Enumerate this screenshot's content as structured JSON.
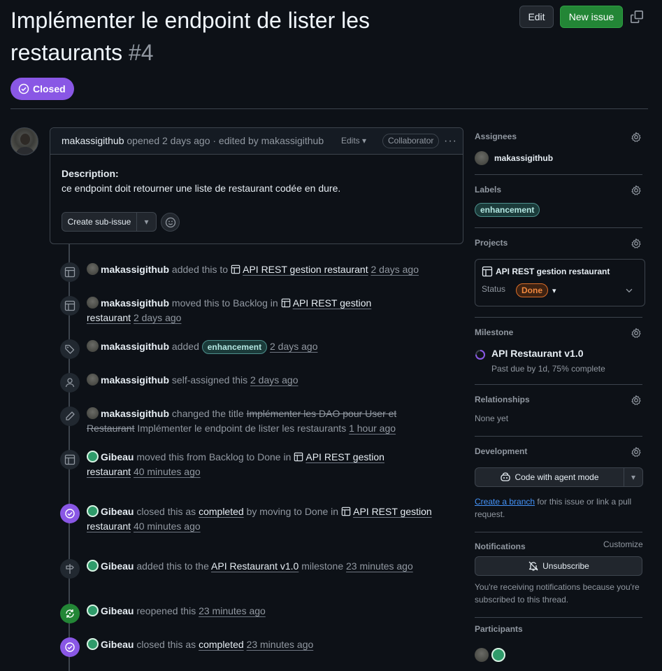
{
  "issue": {
    "title": "Implémenter le endpoint de lister les restaurants",
    "number": "#4",
    "state": "Closed",
    "edit_label": "Edit",
    "new_issue_label": "New issue"
  },
  "comment": {
    "author": "makassigithub",
    "meta": "opened 2 days ago · edited by makassigithub",
    "edits_label": "Edits",
    "role_badge": "Collaborator",
    "desc_heading": "Description:",
    "desc_text": "ce endpoint doit retourner une liste de restaurant codée en dure.",
    "sub_issue_label": "Create sub-issue"
  },
  "timeline": [
    {
      "actor": "makassigithub",
      "p1": "added this to",
      "link": "API REST gestion restaurant",
      "time": "2 days ago",
      "icon": "table-icon"
    },
    {
      "actor": "makassigithub",
      "p1": "moved this to Backlog in",
      "link": "API REST gestion restaurant",
      "time": "2 days ago",
      "icon": "table-icon"
    },
    {
      "actor": "makassigithub",
      "p1": "added",
      "label": "enhancement",
      "time": "2 days ago",
      "icon": "tag-icon"
    },
    {
      "actor": "makassigithub",
      "p1": "self-assigned this",
      "time": "2 days ago",
      "icon": "person-icon"
    },
    {
      "actor": "makassigithub",
      "p1": "changed the title",
      "old_title": "Implémenter les DAO pour User et Restaurant",
      "new_title": "Implémenter le endpoint de lister les restaurants",
      "time": "1 hour ago",
      "icon": "pencil-icon"
    },
    {
      "actor": "Gibeau",
      "p1": "moved this from Backlog to Done in",
      "link": "API REST gestion restaurant",
      "time": "40 minutes ago",
      "icon": "table-icon"
    },
    {
      "actor": "Gibeau",
      "p1": "closed this as",
      "link2": "completed",
      "p2": "by moving to Done in",
      "link": "API REST gestion restaurant",
      "time": "40 minutes ago",
      "icon": "check-circle-icon"
    },
    {
      "actor": "Gibeau",
      "p1": "added this to the",
      "link": "API Restaurant v1.0",
      "p2": "milestone",
      "time": "23 minutes ago",
      "icon": "milestone-icon"
    },
    {
      "actor": "Gibeau",
      "p1": "reopened this",
      "time": "23 minutes ago",
      "icon": "reopen-icon"
    },
    {
      "actor": "Gibeau",
      "p1": "closed this as",
      "link2": "completed",
      "time": "23 minutes ago",
      "icon": "check-circle-icon"
    }
  ],
  "sidebar": {
    "assignees": {
      "title": "Assignees",
      "user": "makassigithub"
    },
    "labels": {
      "title": "Labels",
      "items": [
        "enhancement"
      ]
    },
    "projects": {
      "title": "Projects",
      "name": "API REST gestion restaurant",
      "status_label": "Status",
      "status_value": "Done"
    },
    "milestone": {
      "title": "Milestone",
      "name": "API Restaurant v1.0",
      "detail": "Past due by 1d, 75% complete",
      "progress": 0.75
    },
    "relationships": {
      "title": "Relationships",
      "value": "None yet"
    },
    "development": {
      "title": "Development",
      "agent_label": "Code with agent mode",
      "link_text": "Create a branch",
      "rest_text": "for this issue or link a pull request."
    },
    "notifications": {
      "title": "Notifications",
      "customize": "Customize",
      "unsubscribe": "Unsubscribe",
      "note": "You're receiving notifications because you're subscribed to this thread."
    },
    "participants": {
      "title": "Participants"
    }
  },
  "colors": {
    "accent_purple": "#8957e5",
    "green": "#238636",
    "link_blue": "#4493f8",
    "done_orange": "#f0883e"
  }
}
